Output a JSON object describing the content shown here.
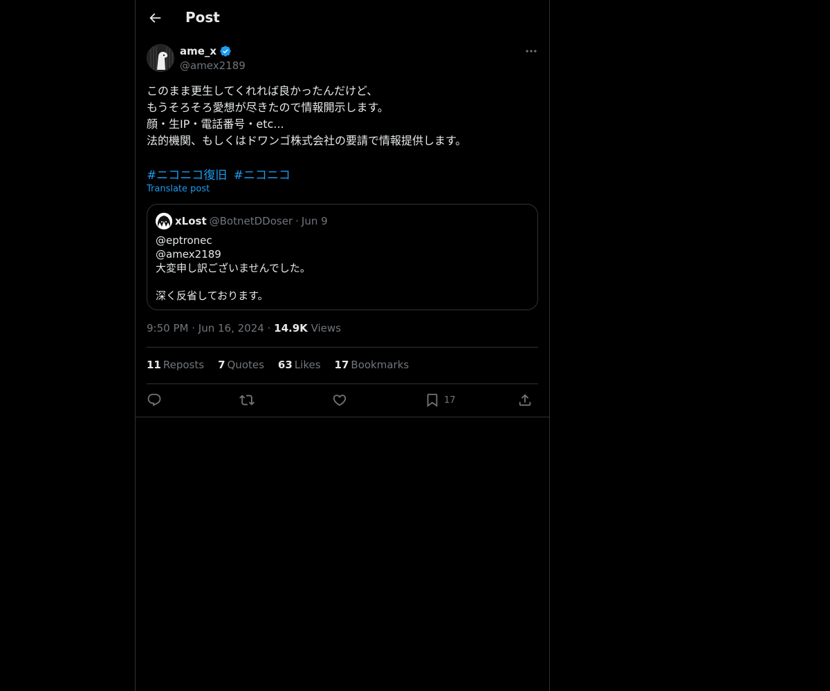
{
  "header": {
    "title": "Post",
    "back_icon": "arrow-left-icon"
  },
  "author": {
    "display_name": "ame_x",
    "handle": "@amex2189",
    "verified_icon": "verified-badge-icon",
    "more_icon": "more-horizontal-icon"
  },
  "post": {
    "lines": [
      "このまま更生してくれれば良かったんだけど、",
      "もうそろそろ愛想が尽きたので情報開示します。",
      "顔・生IP・電話番号・etc...",
      "法的機関、もしくはドワンゴ株式会社の要請で情報提供します。"
    ],
    "hashtags": [
      "#ニコニコ復旧",
      "#ニコニコ"
    ],
    "translate": "Translate post"
  },
  "quote": {
    "name": "xLost",
    "handle": "@BotnetDDoser",
    "dot": "·",
    "date": "Jun 9",
    "lines": [
      "@eptronec",
      "@amex2189",
      "大変申し訳ございませんでした。",
      "",
      "深く反省しております。"
    ]
  },
  "meta": {
    "time": "9:50 PM",
    "dot": "·",
    "date": "Jun 16, 2024",
    "views_count": "14.9K",
    "views_label": "Views"
  },
  "stats": {
    "reposts_count": "11",
    "reposts_label": "Reposts",
    "quotes_count": "7",
    "quotes_label": "Quotes",
    "likes_count": "63",
    "likes_label": "Likes",
    "bookmarks_count": "17",
    "bookmarks_label": "Bookmarks"
  },
  "actions": {
    "reply_icon": "reply-icon",
    "repost_icon": "repost-icon",
    "like_icon": "heart-icon",
    "bookmark_icon": "bookmark-icon",
    "bookmark_count": "17",
    "share_icon": "share-icon"
  },
  "colors": {
    "background": "#000000",
    "accent": "#1d9bf0",
    "muted": "#71767b",
    "border": "#2f3336"
  }
}
